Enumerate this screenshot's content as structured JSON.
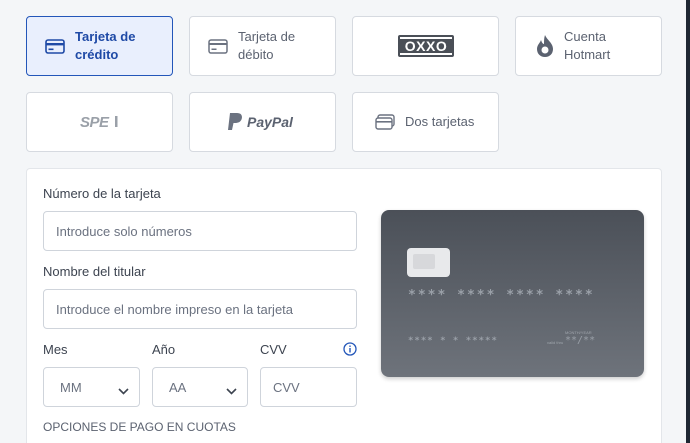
{
  "payment_methods": [
    {
      "label": "Tarjeta de crédito",
      "line1": "Tarjeta de",
      "line2": "crédito",
      "icon": "credit-card-icon",
      "selected": true
    },
    {
      "label": "Tarjeta de débito",
      "line1": "Tarjeta de",
      "line2": "débito",
      "icon": "debit-card-icon",
      "selected": false
    },
    {
      "label": "OXXO",
      "icon": "oxxo-logo",
      "selected": false
    },
    {
      "label": "Cuenta Hotmart",
      "line1": "Cuenta",
      "line2": "Hotmart",
      "icon": "hotmart-flame-icon",
      "selected": false
    },
    {
      "label": "SPEI",
      "icon": "spei-logo",
      "selected": false
    },
    {
      "label": "PayPal",
      "icon": "paypal-logo",
      "selected": false
    },
    {
      "label": "Dos tarjetas",
      "icon": "two-cards-icon",
      "selected": false
    }
  ],
  "form": {
    "card_number_label": "Número de la tarjeta",
    "card_number_placeholder": "Introduce solo números",
    "holder_label": "Nombre del titular",
    "holder_placeholder": "Introduce el nombre impreso en la tarjeta",
    "month_label": "Mes",
    "month_value": "MM",
    "year_label": "Año",
    "year_value": "AA",
    "cvv_label": "CVV",
    "cvv_placeholder": "CVV",
    "installments_label": "OPCIONES DE PAGO EN CUOTAS"
  },
  "card_preview": {
    "number": "**** **** **** ****",
    "name": "**** * * *****",
    "exp_title": "MONTH/YEAR",
    "valid_thru": "valid thru",
    "exp": "**/**"
  },
  "colors": {
    "accent": "#1f4aa6",
    "selected_bg": "#e9effd",
    "border": "#d6dae0"
  }
}
